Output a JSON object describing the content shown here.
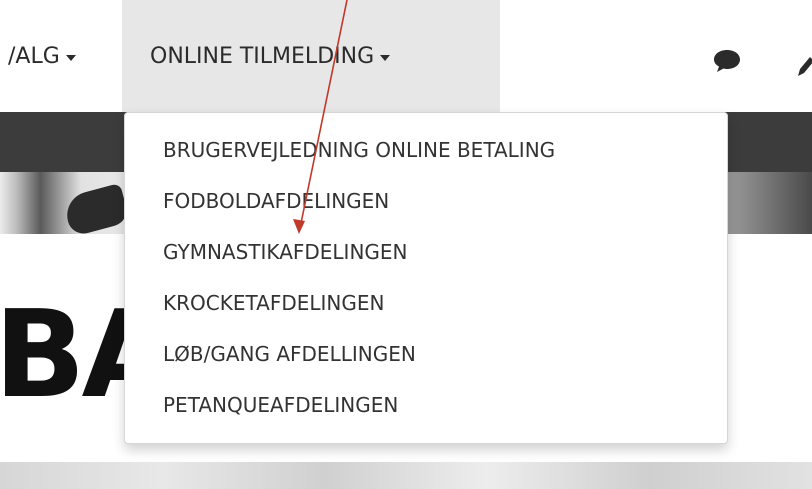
{
  "navbar": {
    "valg_label": "/ALG",
    "online_tilmelding_label": "ONLINE TILMELDING"
  },
  "hero": {
    "big_text": "BA"
  },
  "dropdown": {
    "items": [
      {
        "label": "BRUGERVEJLEDNING ONLINE BETALING"
      },
      {
        "label": "FODBOLDAFDELINGEN"
      },
      {
        "label": "GYMNASTIKAFDELINGEN"
      },
      {
        "label": "KROCKETAFDELINGEN"
      },
      {
        "label": "LØB/GANG AFDELLINGEN"
      },
      {
        "label": "PETANQUEAFDELINGEN"
      }
    ]
  },
  "icons": {
    "chat": "chat-bubble-icon",
    "pencil": "pencil-icon"
  },
  "colors": {
    "nav_active_bg": "#e7e7e7",
    "dark_band": "#3c3c3c",
    "annotation_arrow": "#c0392b"
  }
}
